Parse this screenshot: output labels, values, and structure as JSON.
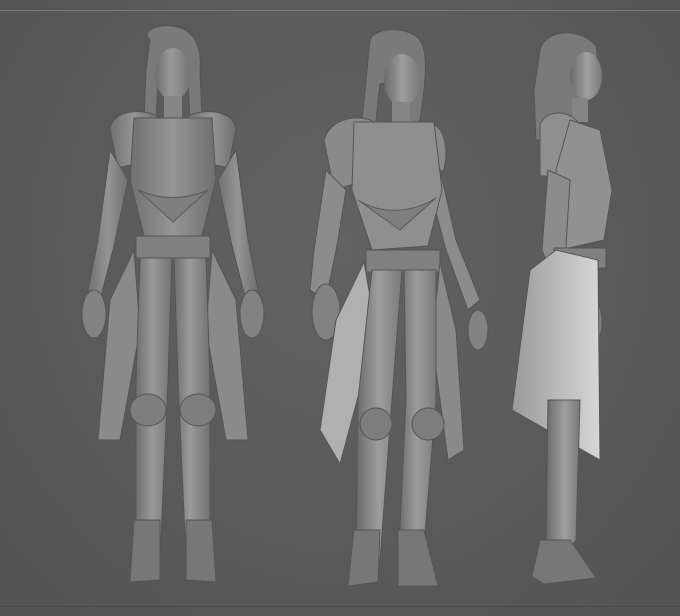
{
  "viewport": {
    "background": "#5b5b5b",
    "model_color": "#8d8d8d",
    "highlight_color": "#b8b8b8",
    "shadow_color": "#4a4a4a"
  },
  "views": [
    {
      "id": "front",
      "label": ""
    },
    {
      "id": "three-quarter",
      "label": ""
    },
    {
      "id": "side",
      "label": ""
    }
  ]
}
